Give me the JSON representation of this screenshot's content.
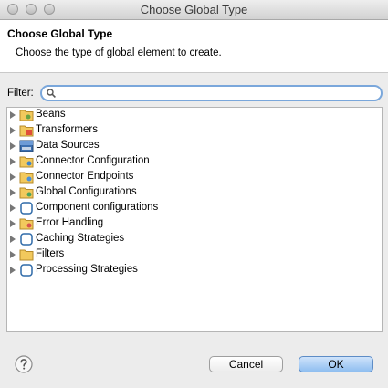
{
  "window": {
    "title": "Choose Global Type"
  },
  "header": {
    "title": "Choose Global Type",
    "description": "Choose the type of global element to create."
  },
  "filter": {
    "label": "Filter:",
    "value": "",
    "placeholder": ""
  },
  "tree": {
    "items": [
      {
        "label": "Beans",
        "icon": "folder-bean-icon"
      },
      {
        "label": "Transformers",
        "icon": "folder-transformer-icon"
      },
      {
        "label": "Data Sources",
        "icon": "sql-database-icon"
      },
      {
        "label": "Connector Configuration",
        "icon": "folder-connector-icon"
      },
      {
        "label": "Connector Endpoints",
        "icon": "folder-endpoint-icon"
      },
      {
        "label": "Global Configurations",
        "icon": "folder-config-icon"
      },
      {
        "label": "Component configurations",
        "icon": "component-frame-icon"
      },
      {
        "label": "Error Handling",
        "icon": "folder-error-icon"
      },
      {
        "label": "Caching Strategies",
        "icon": "component-frame-icon"
      },
      {
        "label": "Filters",
        "icon": "folder-icon"
      },
      {
        "label": "Processing Strategies",
        "icon": "component-frame-icon"
      }
    ]
  },
  "buttons": {
    "cancel": "Cancel",
    "ok": "OK"
  },
  "colors": {
    "ok_button": "#8fbef0",
    "folder": "#e6b44a",
    "focus_ring": "#7aa7db"
  }
}
